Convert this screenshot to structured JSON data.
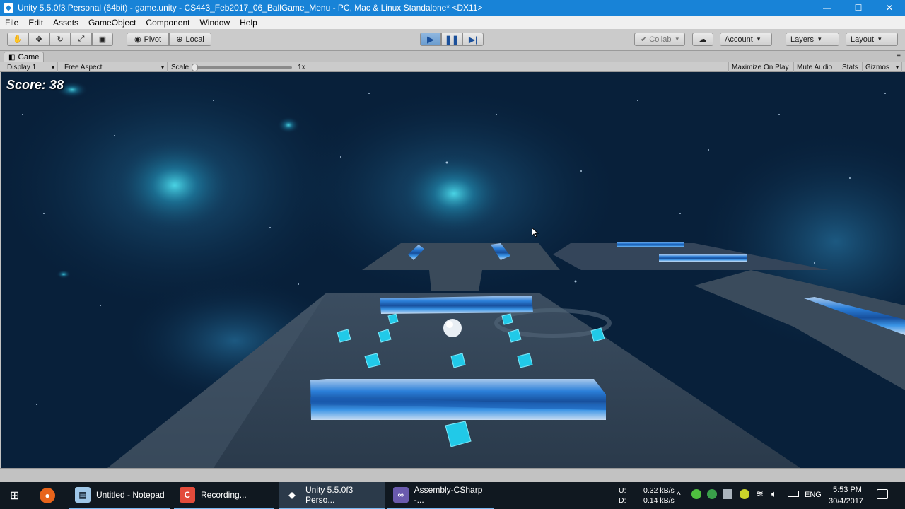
{
  "window": {
    "title": "Unity 5.5.0f3 Personal (64bit) - game.unity - CS443_Feb2017_06_BallGame_Menu - PC, Mac & Linux Standalone* <DX11>",
    "controls": {
      "minimize": "—",
      "maximize": "☐",
      "close": "✕"
    }
  },
  "menu": [
    "File",
    "Edit",
    "Assets",
    "GameObject",
    "Component",
    "Window",
    "Help"
  ],
  "toolbar": {
    "pivot": "Pivot",
    "local": "Local",
    "collab": "Collab",
    "account": "Account",
    "layers": "Layers",
    "layout": "Layout"
  },
  "game_tab": {
    "tab_label": "Game",
    "display": "Display 1",
    "aspect": "Free Aspect",
    "scale_label": "Scale",
    "scale_value": "1x",
    "maximize_on_play": "Maximize On Play",
    "mute_audio": "Mute Audio",
    "stats": "Stats",
    "gizmos": "Gizmos"
  },
  "game": {
    "score": "Score: 38"
  },
  "taskbar": {
    "items": [
      {
        "label": "Untitled - Notepad"
      },
      {
        "label": "Recording..."
      },
      {
        "label": "Unity 5.5.0f3 Perso..."
      },
      {
        "label": "Assembly-CSharp -..."
      }
    ],
    "net_up_label": "U:",
    "net_down_label": "D:",
    "net_up": "0.32 kB/s",
    "net_down": "0.14 kB/s",
    "language": "ENG",
    "time": "5:53 PM",
    "date": "30/4/2017"
  }
}
